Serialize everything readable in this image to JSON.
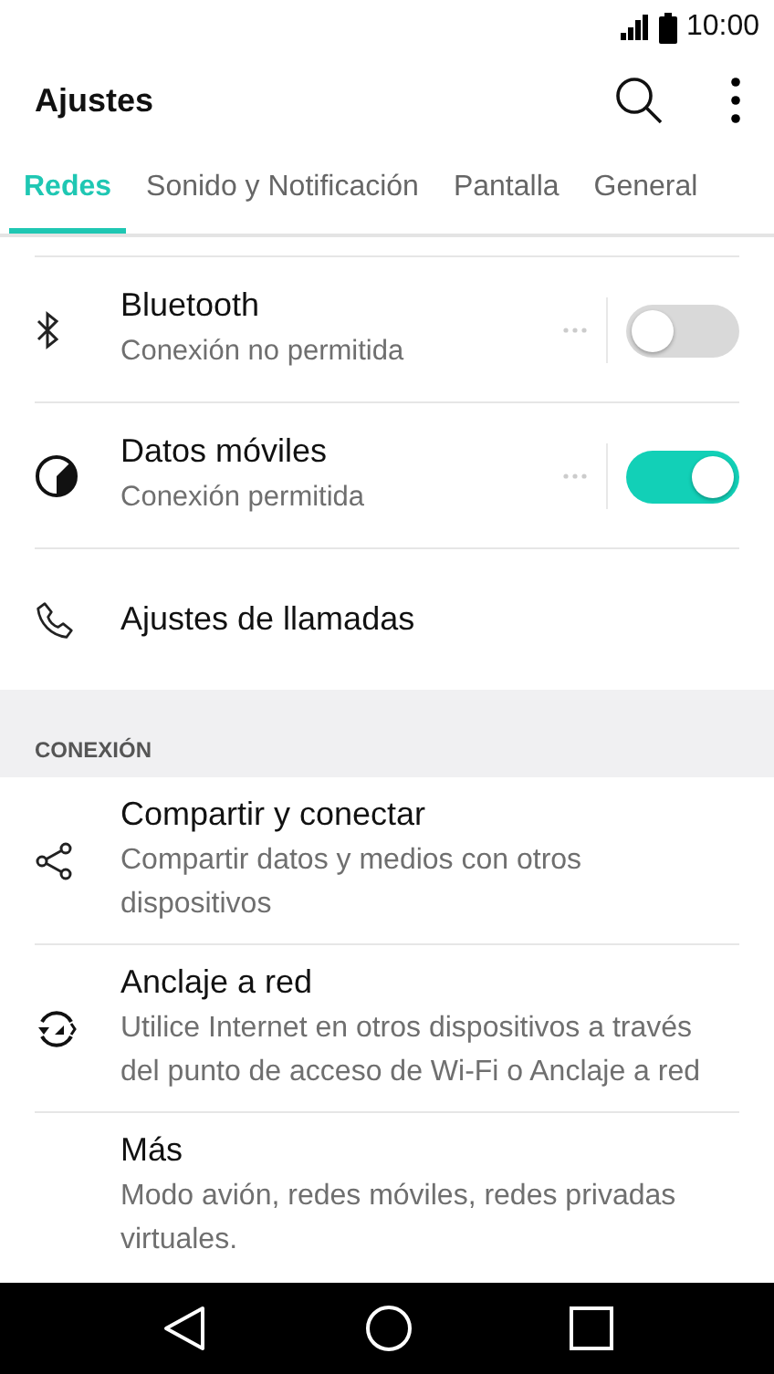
{
  "status_bar": {
    "time": "10:00"
  },
  "toolbar": {
    "title": "Ajustes"
  },
  "tabs": [
    {
      "label": "Redes",
      "selected": true
    },
    {
      "label": "Sonido y Notificación",
      "selected": false
    },
    {
      "label": "Pantalla",
      "selected": false
    },
    {
      "label": "General",
      "selected": false
    }
  ],
  "items": [
    {
      "kind": "toggle",
      "title": "Bluetooth",
      "subtitle": "Conexión no permitida",
      "on": false
    },
    {
      "kind": "toggle",
      "title": "Datos móviles",
      "subtitle": "Conexión permitida",
      "on": true
    },
    {
      "kind": "plain",
      "title": "Ajustes de llamadas"
    }
  ],
  "section": {
    "header": "CONEXIÓN",
    "items": [
      {
        "title": "Compartir y conectar",
        "subtitle": "Compartir datos y medios con otros dispositivos"
      },
      {
        "title": "Anclaje a red",
        "subtitle": "Utilice Internet en otros dispositivos a través del punto de acceso de Wi-Fi o Anclaje a red"
      },
      {
        "title": "Más",
        "subtitle": "Modo avión, redes móviles, redes privadas virtuales."
      }
    ]
  }
}
